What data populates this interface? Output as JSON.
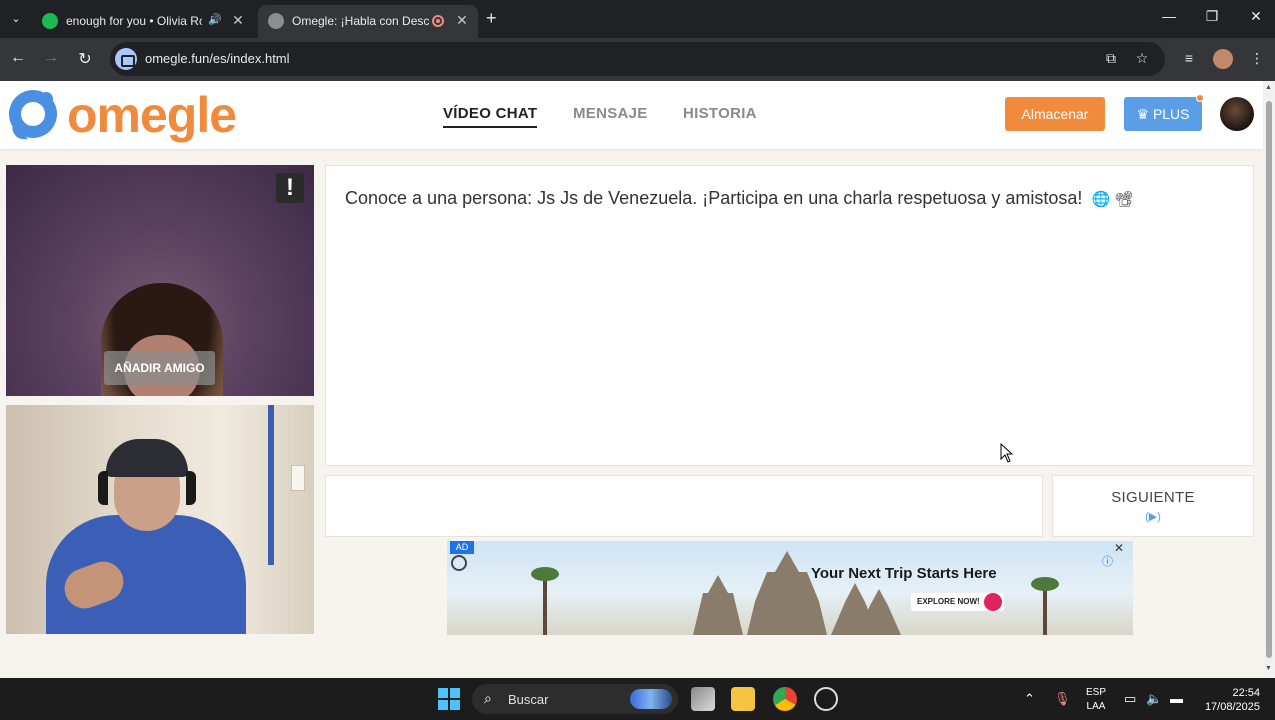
{
  "browser": {
    "tabs": [
      {
        "title": "enough for you • Olivia Rodrigo",
        "active": false
      },
      {
        "title": "Omegle: ¡Habla con Desconocidos!",
        "active": true
      }
    ],
    "url": "omegle.fun/es/index.html"
  },
  "site": {
    "logo_text": "omegle",
    "nav": [
      {
        "label": "VÍDEO CHAT",
        "active": true
      },
      {
        "label": "MENSAJE",
        "active": false
      },
      {
        "label": "HISTORIA",
        "active": false
      }
    ],
    "store_label": "Almacenar",
    "plus_label": "PLUS"
  },
  "video": {
    "report_label": "!",
    "add_friend_label": "AÑADIR AMIGO"
  },
  "chat": {
    "message": "Conoce a una persona: Js Js de Venezuela. ¡Participa en una charla respetuosa y amistosa!",
    "message_emoji": "🌐 📽",
    "next_label": "SIGUIENTE",
    "next_hint": "(▶)"
  },
  "ad": {
    "badge": "AD",
    "headline": "Your Next Trip Starts Here",
    "cta": "EXPLORE NOW!"
  },
  "taskbar": {
    "search_placeholder": "Buscar",
    "lang_line1": "ESP",
    "lang_line2": "LAA",
    "time": "22:54",
    "date": "17/08/2025"
  },
  "colors": {
    "brand_orange": "#f08a3c",
    "brand_blue": "#5b9ee8",
    "page_bg": "#f7f3ee"
  }
}
